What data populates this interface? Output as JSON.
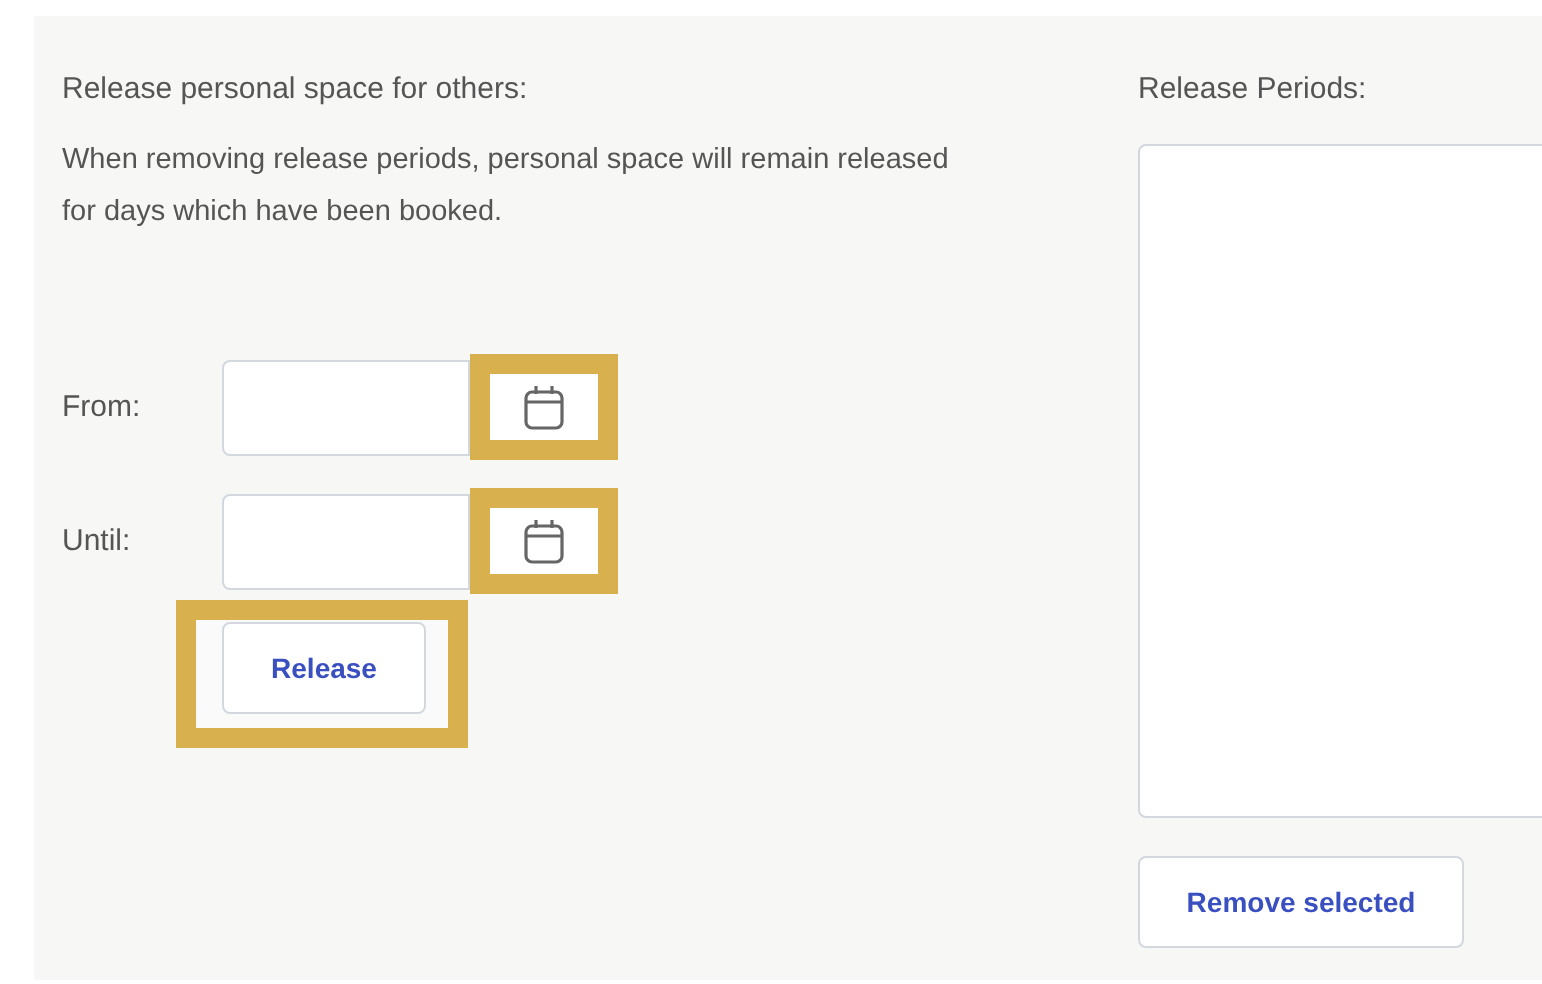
{
  "release_form": {
    "title": "Release personal space for others:",
    "note": "When removing release periods, personal space will remain released for days which have been booked.",
    "fields": [
      {
        "label": "From:",
        "calendar_highlighted": true
      },
      {
        "label": "Until:",
        "calendar_highlighted": true
      }
    ],
    "release_button": {
      "label": "Release",
      "highlighted": true
    }
  },
  "release_periods": {
    "title": "Release Periods:",
    "remove_button": {
      "label": "Remove selected",
      "highlighted": false
    }
  }
}
